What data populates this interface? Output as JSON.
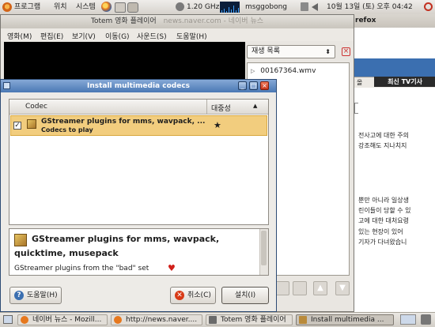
{
  "top_panel": {
    "menus": [
      "프로그램",
      "위치",
      "시스템"
    ],
    "cpu": "1.20 GHz",
    "user": "msggobong",
    "clock": "10월 13일 (토) 오후 04:42"
  },
  "firefox": {
    "title_fragment": "refox",
    "tab_label": "최신 TV기사",
    "tab_partial": "올",
    "lines": [
      "전사고에 대한 주의",
      "강조해도 지나치지",
      "뿐만 아니라 일상생",
      "린이들이 당할 수 있",
      "고에 대한 대처요령",
      "있는 현장이 있어",
      "기자가 다녀왔습니"
    ]
  },
  "totem": {
    "title": "Totem 영화 플레이어",
    "title_url": "news.naver.com - 네이버 뉴스",
    "menu": [
      "영화(M)",
      "편집(E)",
      "보기(V)",
      "이동(G)",
      "사운드(S)",
      "도움말(H)"
    ],
    "playlist_label": "재생 목록",
    "playlist_items": [
      "00167364.wmv"
    ]
  },
  "dialog": {
    "title": "Install multimedia codecs",
    "columns": {
      "codec": "Codec",
      "popularity": "대중성"
    },
    "row": {
      "name": "GStreamer plugins for mms, wavpack, ...",
      "sub": "Codecs to play",
      "checked": true,
      "popularity_icon": "star"
    },
    "detail": {
      "heading_line1": "GStreamer plugins for mms, wavpack,",
      "heading_line2": "quicktime, musepack",
      "desc": "GStreamer plugins from the \"bad\" set"
    },
    "buttons": {
      "help": "도움말(H)",
      "cancel": "취소(C)",
      "install": "설치(I)"
    }
  },
  "taskbar": [
    {
      "label": "네이버 뉴스 - Mozill...",
      "active": false
    },
    {
      "label": "http://news.naver....",
      "active": false
    },
    {
      "label": "Totem 영화 플레이어",
      "active": false
    },
    {
      "label": "Install multimedia ...",
      "active": true
    }
  ],
  "colors": {
    "selection": "#f2cd7e",
    "titlebar_active": "#4a78b4",
    "close_red": "#d83a16"
  }
}
